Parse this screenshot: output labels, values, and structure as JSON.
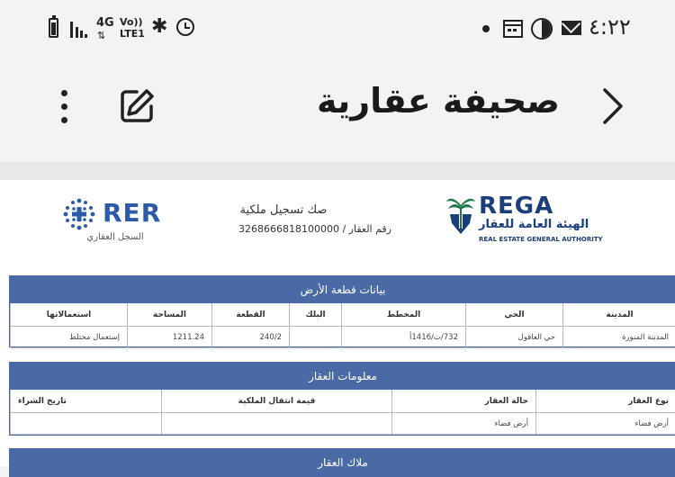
{
  "status_bar": {
    "time": "٤:٢٢",
    "network": "4G",
    "volte": "Vo)) LTE1"
  },
  "app_bar": {
    "title": "صحيفة عقارية"
  },
  "doc_header": {
    "deed_title": "صك تسجيل ملكية",
    "property_number_label": "رقم العقار /",
    "property_number": "3268666818100000",
    "rega_name": "REGA",
    "rega_ar": "الهيئة العامة للعقار",
    "rega_en": "REAL ESTATE GENERAL AUTHORITY",
    "rer_name": "RER",
    "rer_ar": "السجل العقاري"
  },
  "land_section": {
    "title": "بيانات قطعة الأرض",
    "headers": [
      "المدينة",
      "الحي",
      "المخطط",
      "البلك",
      "القطعة",
      "المساحة",
      "استعمالاتها"
    ],
    "values": [
      "المدينة المنورة",
      "حي العاقول",
      "732/ت/1416أ",
      "",
      "240/2",
      "1211.24",
      "إستعمال مختلط"
    ]
  },
  "property_section": {
    "title": "معلومات العقار",
    "headers": [
      "نوع العقار",
      "حالة العقار",
      "قيمة انتقال الملكية",
      "تاريخ الشراء"
    ],
    "values": [
      "أرض فضاء",
      "أرض فضاء",
      "",
      ""
    ]
  },
  "owners_section": {
    "title": "ملاك العقار"
  },
  "colors": {
    "section_header": "#4a6aa6",
    "rega_green": "#1f7a4b",
    "rega_blue": "#1b3f7a",
    "rer_blue": "#2a5aa8"
  }
}
